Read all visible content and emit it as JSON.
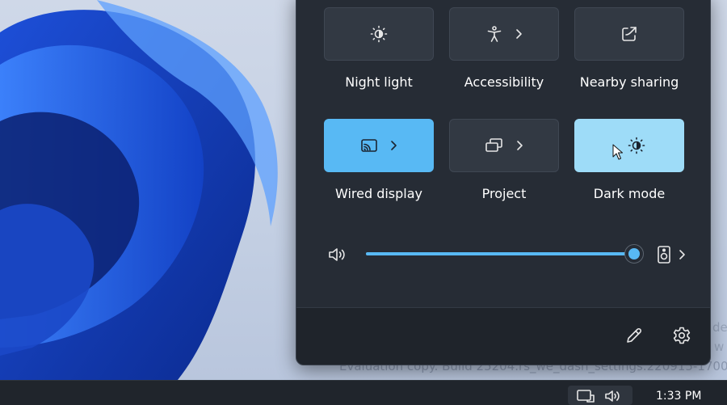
{
  "quick_settings": {
    "tiles_row1": [
      {
        "label": "Night light",
        "icon": "brightness-icon",
        "active": false
      },
      {
        "label": "Accessibility",
        "icon": "accessibility-icon",
        "active": false
      },
      {
        "label": "Nearby sharing",
        "icon": "share-icon",
        "active": false
      }
    ],
    "tiles_row2": [
      {
        "label": "Wired display",
        "icon": "cast-icon",
        "active": true
      },
      {
        "label": "Project",
        "icon": "project-icon",
        "active": false
      },
      {
        "label": "Dark mode",
        "icon": "brightness-icon",
        "active": true
      }
    ],
    "volume": {
      "icon": "speaker-icon",
      "level": 1.0,
      "output_icon": "audio-device-icon"
    },
    "footer": {
      "edit_icon": "pencil-icon",
      "settings_icon": "gear-icon"
    }
  },
  "watermark": {
    "text": "Evaluation copy. Build 25204.rs_we_dash_settings.220915-1700",
    "fragment_1": "de",
    "fragment_2": "w"
  },
  "taskbar": {
    "time": "1:33 PM",
    "tray_icons": [
      "network-icon",
      "volume-icon"
    ]
  },
  "colors": {
    "accent": "#58b9f4",
    "panel": "#262c35",
    "tile": "#323943"
  }
}
